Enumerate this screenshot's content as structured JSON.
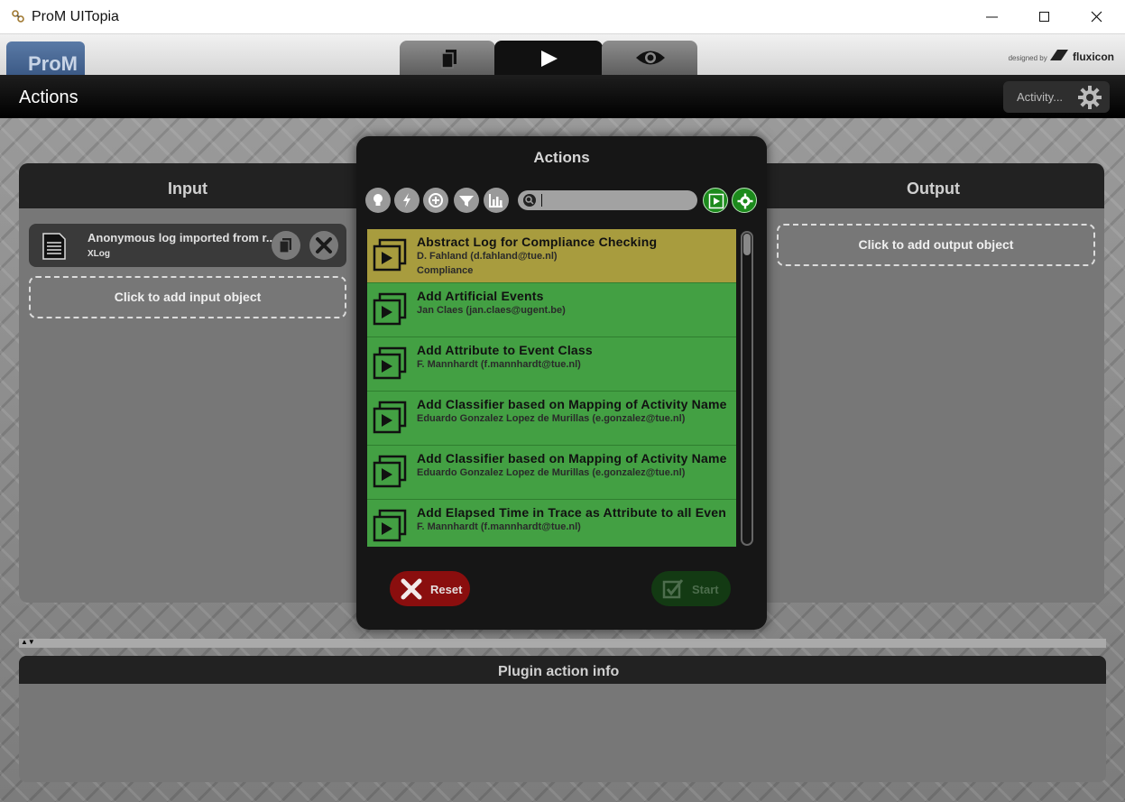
{
  "window": {
    "title": "ProM UITopia",
    "icon": "prom-app-icon"
  },
  "header": {
    "logo_text": "ProM",
    "tabs": [
      {
        "name": "workspace",
        "icon": "documents-icon"
      },
      {
        "name": "actions",
        "icon": "play-icon",
        "active": true
      },
      {
        "name": "view",
        "icon": "eye-icon"
      }
    ],
    "designed_by": "designed by",
    "brand": "fluxicon"
  },
  "actions_bar": {
    "title": "Actions",
    "activity_label": "Activity..."
  },
  "input_panel": {
    "title": "Input",
    "object": {
      "name": "Anonymous log imported from r...",
      "type": "XLog"
    },
    "add_label": "Click to add input object"
  },
  "output_panel": {
    "title": "Output",
    "add_label": "Click to add output object"
  },
  "info_panel": {
    "title": "Plugin action info"
  },
  "modal": {
    "title": "Actions",
    "filters": [
      "lightbulb-icon",
      "lightning-icon",
      "plus-circle-icon",
      "funnel-icon",
      "bar-chart-icon"
    ],
    "search_value": "",
    "plugins": [
      {
        "name": "Abstract Log for Compliance Checking",
        "author": "D. Fahland (d.fahland@tue.nl)",
        "category": "Compliance",
        "selected": true
      },
      {
        "name": "Add Artificial Events",
        "author": "Jan Claes (jan.claes@ugent.be)",
        "category": ""
      },
      {
        "name": "Add Attribute to Event Class",
        "author": " F. Mannhardt (f.mannhardt@tue.nl)",
        "category": ""
      },
      {
        "name": "Add Classifier based on Mapping of Activity Name",
        "author": "Eduardo Gonzalez Lopez de Murillas (e.gonzalez@tue.nl)",
        "category": ""
      },
      {
        "name": "Add Classifier based on Mapping of Activity Name",
        "author": "Eduardo Gonzalez Lopez de Murillas (e.gonzalez@tue.nl)",
        "category": ""
      },
      {
        "name": "Add Elapsed Time in Trace as Attribute to all Even",
        "author": " F. Mannhardt (f.mannhardt@tue.nl)",
        "category": ""
      }
    ],
    "reset_label": "Reset",
    "start_label": "Start"
  },
  "colors": {
    "plugin_green": "#43a043",
    "plugin_selected": "#a89c3e",
    "reset_red": "#8a0e0e",
    "start_green_disabled": "#133a13"
  }
}
